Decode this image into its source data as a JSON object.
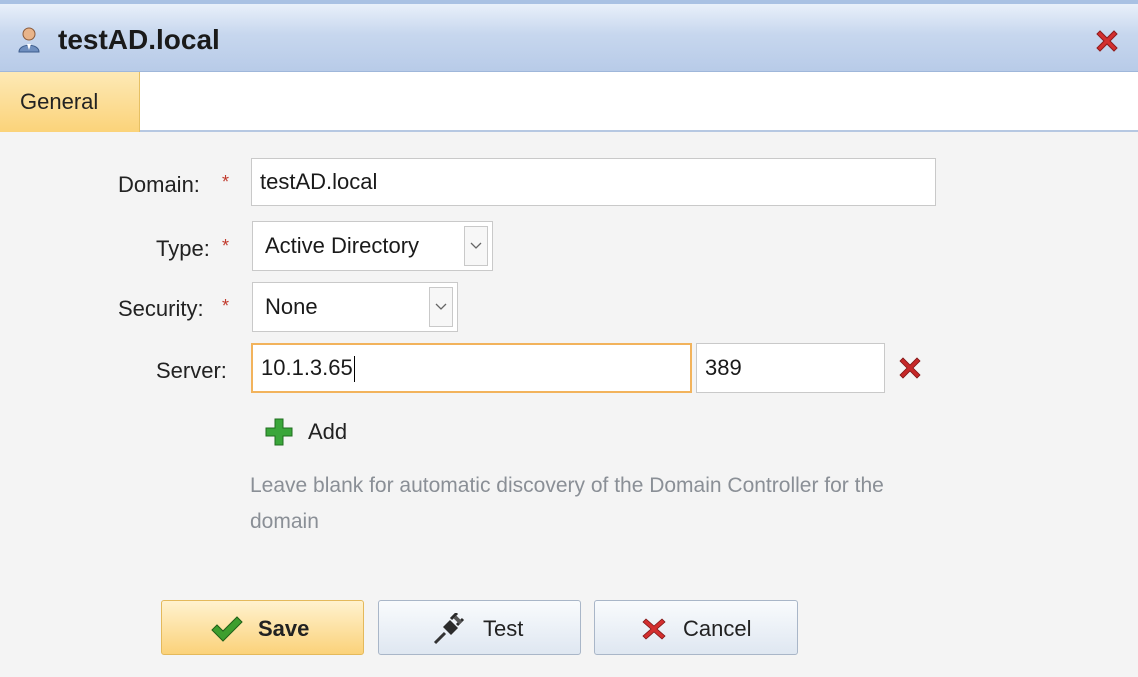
{
  "window": {
    "title": "testAD.local",
    "title_icon": "user-icon",
    "close_icon": "close-icon"
  },
  "tabs": [
    {
      "label": "General",
      "active": true
    }
  ],
  "form": {
    "domain": {
      "label": "Domain:",
      "required": "*",
      "value": "testAD.local"
    },
    "type": {
      "label": "Type:",
      "required": "*",
      "value": "Active Directory"
    },
    "security": {
      "label": "Security:",
      "required": "*",
      "value": "None"
    },
    "server": {
      "label": "Server:",
      "address": "10.1.3.65",
      "port": "389",
      "remove_icon": "remove-icon"
    },
    "add_label": "Add",
    "hint": "Leave blank for automatic discovery of the Domain Controller for the domain"
  },
  "buttons": {
    "save": "Save",
    "test": "Test",
    "cancel": "Cancel"
  },
  "colors": {
    "accent": "#fbd37a",
    "required": "#c0392b",
    "remove": "#c62828",
    "add": "#3aa63a",
    "hint": "#8a8f96"
  }
}
